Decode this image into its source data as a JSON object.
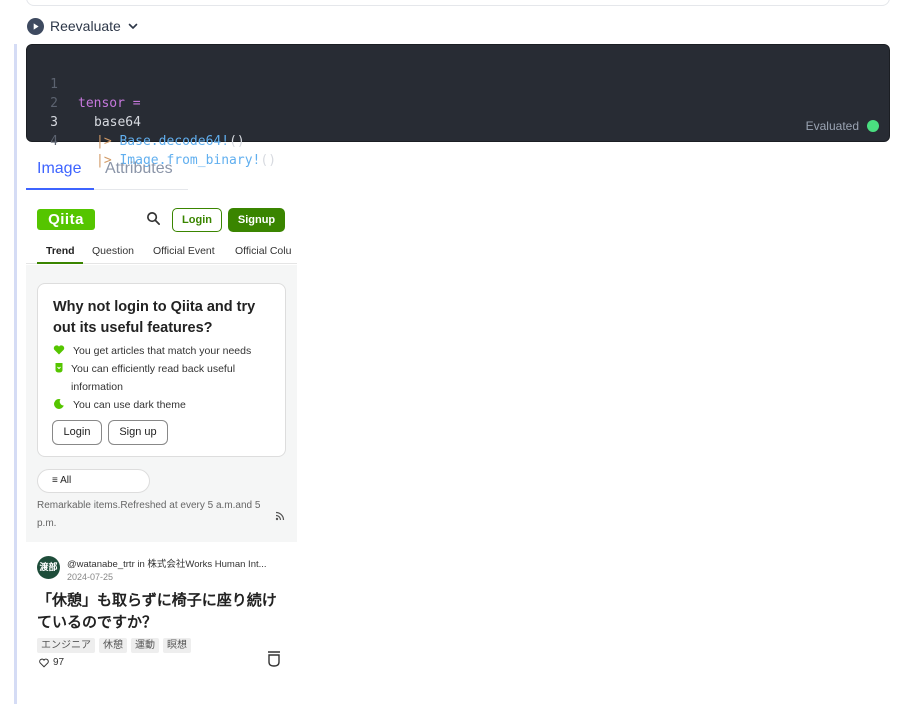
{
  "toolbar": {
    "reevaluate_label": "Reevaluate"
  },
  "code": {
    "lines": [
      {
        "number": "1",
        "text": "tensor ="
      },
      {
        "number": "2",
        "text": "base64"
      },
      {
        "number": "3",
        "pipe": "|>",
        "call": "Base.decode64!",
        "args": "()"
      },
      {
        "number": "4",
        "pipe": "|>",
        "call": "Image.from_binary!",
        "args": "()"
      }
    ],
    "active_line": "3",
    "status": "Evaluated",
    "status_color": "#4ade80"
  },
  "tabs": [
    {
      "label": "Image",
      "active": true
    },
    {
      "label": "Attributes",
      "active": false
    }
  ],
  "qiita": {
    "logo": "Qiita",
    "login": "Login",
    "signup": "Signup",
    "brand_color": "#55c500",
    "nav": [
      "Trend",
      "Question",
      "Official Event",
      "Official Colu"
    ],
    "promo": {
      "title": "Why not login to Qiita and try out its useful features?",
      "features": [
        "You get articles that match your needs",
        "You can efficiently read back useful information",
        "You can use dark theme"
      ],
      "login": "Login",
      "signup": "Sign up"
    },
    "filter": "All",
    "remark": "Remarkable items.Refreshed at every 5 a.m.and 5 p.m.",
    "article": {
      "avatar_text": "渡部",
      "author": "@watanabe_trtr in 株式会社Works Human Int...",
      "date": "2024-07-25",
      "title": "「休憩」も取らずに椅子に座り続けているのですか？",
      "tags": [
        "エンジニア",
        "休憩",
        "運動",
        "瞑想"
      ],
      "likes": "97"
    }
  }
}
